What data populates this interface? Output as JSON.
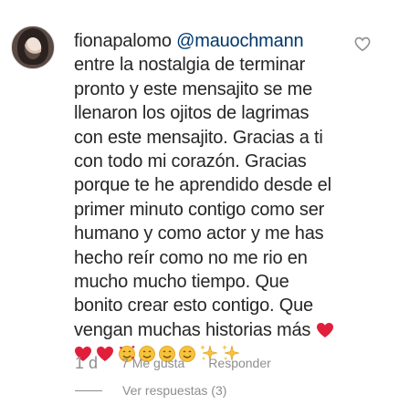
{
  "comment": {
    "username": "fionapalomo",
    "mention": "@mauochmann",
    "lines": [
      "entre la nostalgia de terminar",
      "pronto y este mensajito se me",
      "llenaron los ojitos de lagrimas",
      "con este mensajito. Gracias a ti",
      "con todo mi corazón. Gracias",
      "porque te he aprendido desde el",
      "primer minuto contigo como ser",
      "humano y como actor y me has",
      "hecho reír como no me rio en",
      "mucho mucho tiempo. Que",
      "bonito crear esto contigo. Que"
    ],
    "last_line": "vengan muchas historias más",
    "emojis": [
      "red-heart",
      "red-heart",
      "red-heart",
      "smiling-face-with-hearts",
      "smiling-face",
      "smiling-face",
      "smiling-face",
      "sparkles",
      "sparkles"
    ],
    "time": "1 d",
    "likes": "7 Me gusta",
    "reply": "Responder",
    "view_replies": "Ver respuestas (3)"
  },
  "colors": {
    "text": "#262626",
    "mention": "#00376b",
    "secondary": "#8e8e8e",
    "heart": "#e0203a",
    "emoji_yellow": "#f7c23a"
  }
}
